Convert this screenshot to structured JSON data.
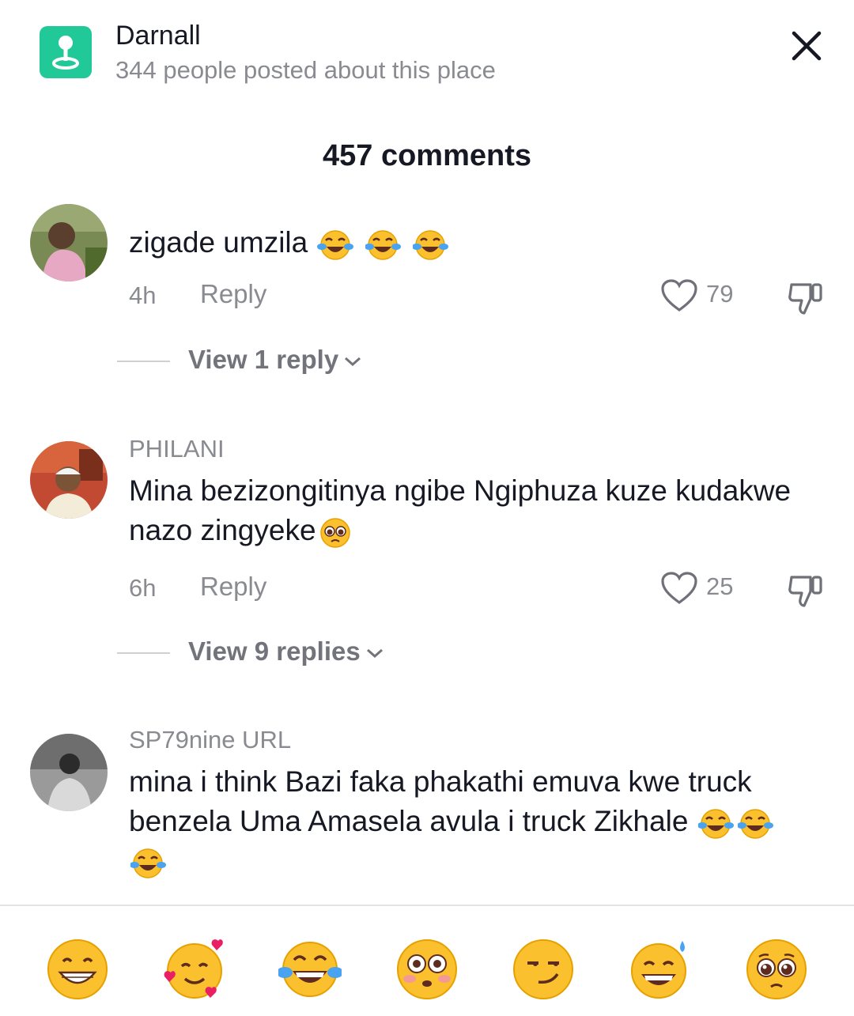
{
  "location": {
    "title": "Darnall",
    "subtitle": "344 people posted about this place",
    "icon": "location-pin-icon"
  },
  "comments_header": "457 comments",
  "comments": [
    {
      "username": "",
      "text": "zigade umzila",
      "emojis": [
        "tears-of-joy",
        "tears-of-joy",
        "tears-of-joy"
      ],
      "time": "4h",
      "reply_label": "Reply",
      "likes": "79",
      "view_replies": "View 1 reply"
    },
    {
      "username": "PHILANI",
      "text": "Mina bezizongitinya ngibe Ngiphuza kuze kudakwe nazo zingyeke",
      "emojis": [
        "pleading-face"
      ],
      "time": "6h",
      "reply_label": "Reply",
      "likes": "25",
      "view_replies": "View 9 replies"
    },
    {
      "username": "SP79nine URL",
      "text": "mina i think Bazi faka phakathi emuva kwe truck benzela Uma Amasela avula i truck Zikhale",
      "emojis": [
        "tears-of-joy",
        "tears-of-joy",
        "tears-of-joy"
      ]
    }
  ],
  "quick_emojis": [
    "grinning-face",
    "smiling-face-with-hearts",
    "tears-of-joy",
    "flushed-face",
    "smirking-face",
    "grinning-sweat-face",
    "pleading-face"
  ],
  "colors": {
    "accent_green": "#20c997",
    "text_primary": "#161823",
    "text_secondary": "#8a8b91"
  }
}
